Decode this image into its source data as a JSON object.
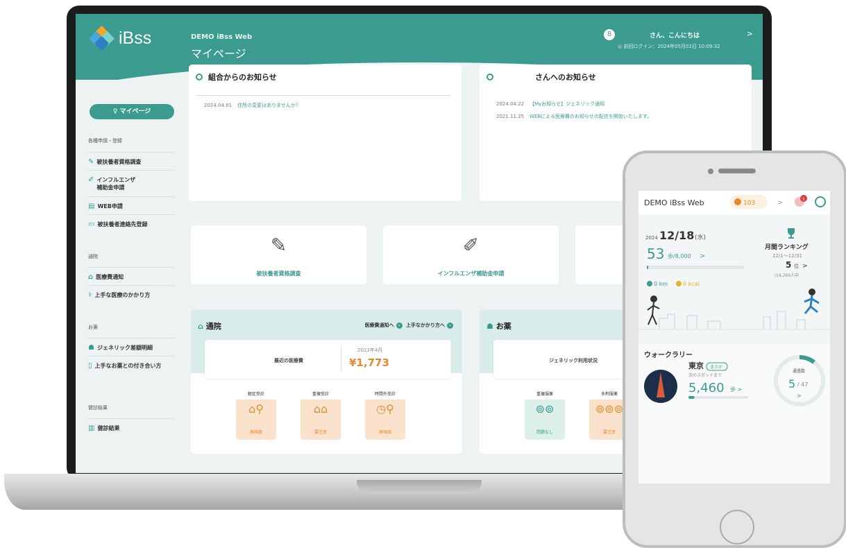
{
  "laptop": {
    "brand": "iBss",
    "site_name": "DEMO iBss Web",
    "page_title": "マイページ",
    "user": {
      "avatar_glyph": "8",
      "greeting": "さん、こんにちは",
      "arrow": ">",
      "last_login": "◎ 前回ログイン：2024年05月02日 10:09:32"
    },
    "sidebar": {
      "mypage_button": "マイページ",
      "sections": [
        {
          "title": "各種申請・登録",
          "items": [
            {
              "label": "被扶養者資格調査",
              "icon": "pen-icon"
            },
            {
              "label": "インフルエンザ\n補助金申請",
              "icon": "syringe-icon"
            },
            {
              "label": "WEB申請",
              "icon": "document-icon"
            },
            {
              "label": "被扶養者連絡先登録",
              "icon": "id-card-icon"
            }
          ]
        },
        {
          "title": "通院",
          "items": [
            {
              "label": "医療費通知",
              "icon": "hospital-icon"
            },
            {
              "label": "上手な医療のかかり方",
              "icon": "stethoscope-icon"
            }
          ]
        },
        {
          "title": "お薬",
          "items": [
            {
              "label": "ジェネリック差額明細",
              "icon": "pill-icon"
            },
            {
              "label": "上手なお薬との付き合い方",
              "icon": "medicine-bottle-icon"
            }
          ]
        },
        {
          "title": "健診結果",
          "items": [
            {
              "label": "健診結果",
              "icon": "chart-icon"
            }
          ]
        }
      ]
    },
    "notices": {
      "org": {
        "title": "組合からのお知らせ",
        "items": [
          {
            "date": "2024.04.01",
            "text": "住所の変更はありませんか？"
          }
        ]
      },
      "personal": {
        "title": "さんへのお知らせ",
        "items": [
          {
            "date": "2024.04.22",
            "text": "【Myお知らせ】ジェネリック通知"
          },
          {
            "date": "2021.11.25",
            "text": "WEBによる医療費のお知らせの配信を開始いたします。"
          }
        ]
      }
    },
    "quick_tiles": [
      {
        "label": "被扶養者資格調査",
        "icon": "pen-icon"
      },
      {
        "label": "インフルエンザ補助金申請",
        "icon": "syringe-icon"
      }
    ],
    "visit_panel": {
      "title": "通院",
      "link1": "医療費通知へ",
      "link2": "上手なかかり方へ",
      "summary_label": "最近の医療費",
      "summary_month": "2022年4月",
      "summary_amount": "¥1,773",
      "tips": [
        {
          "top": "軽症受診",
          "bottom": "高頻度"
        },
        {
          "top": "重複受診",
          "bottom": "要注意"
        },
        {
          "top": "時間外受診",
          "bottom": "高頻度"
        }
      ]
    },
    "medicine_panel": {
      "title": "お薬",
      "summary_label": "ジェネリック利用状況",
      "tips": [
        {
          "top": "重複服薬",
          "bottom": "問題なし"
        },
        {
          "top": "多剤服薬",
          "bottom": "要注意"
        }
      ]
    }
  },
  "phone": {
    "app_title": "DEMO iBss Web",
    "points": "103",
    "arrow": ">",
    "notification_count": "1",
    "date_year": "2024",
    "date": "12/18",
    "weekday": "(水)",
    "steps": "53",
    "steps_goal": "歩/8,000",
    "step_progress": 0.006625,
    "distance": "0 km",
    "calories": "0 kcal",
    "ranking_title": "月間ランキング",
    "ranking_period": "12/1〜12/31",
    "rank": "5",
    "rank_unit": "位",
    "rank_total": "/14,269人中",
    "walk_rally_title": "ウォークラリー",
    "city": "東京",
    "city_badge": "まさか",
    "next_spot_label": "次のスポットまで",
    "next_spot_steps": "5,460",
    "spot_progress": 0.1,
    "spots_label": "通過数",
    "spots_done": "5",
    "spots_total": "/ 47",
    "spots_ratio": 0.106
  },
  "colors": {
    "primary": "#3b9b8f",
    "accent": "#e68a2e",
    "tile": "#fae2cc",
    "panel_tint": "#d9ece9"
  }
}
